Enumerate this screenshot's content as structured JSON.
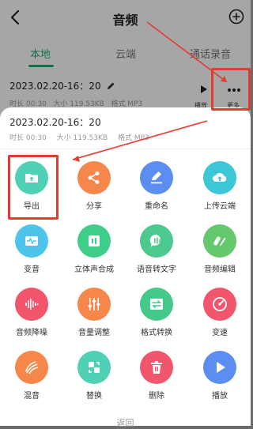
{
  "header": {
    "title": "音频"
  },
  "tabs": [
    {
      "label": "本地",
      "active": true
    },
    {
      "label": "云端",
      "active": false
    },
    {
      "label": "通话录音",
      "active": false
    }
  ],
  "recording": {
    "name": "2023.02.20-16：20",
    "duration": "时长 00:30",
    "size": "大小 119.53KB",
    "format": "格式 MP3",
    "play_label": "播放",
    "more_label": "更多"
  },
  "sheet": {
    "name": "2023.02.20-16：20",
    "duration": "时长 00:30",
    "size": "大小 119.53KB",
    "format": "格式 MP3",
    "actions": [
      {
        "label": "导出",
        "icon": "folder-upload-icon",
        "color": "#4fd0b4"
      },
      {
        "label": "分享",
        "icon": "share-icon",
        "color": "#f6874a"
      },
      {
        "label": "重命名",
        "icon": "rename-icon",
        "color": "#5c8ef2"
      },
      {
        "label": "上传云端",
        "icon": "cloud-upload-icon",
        "color": "#3cc6d8"
      },
      {
        "label": "变音",
        "icon": "voice-change-icon",
        "color": "#4dc4ea"
      },
      {
        "label": "立体声合成",
        "icon": "stereo-icon",
        "color": "#3fce8a"
      },
      {
        "label": "语音转文字",
        "icon": "speech-to-text-icon",
        "color": "#4cc98e"
      },
      {
        "label": "音频编辑",
        "icon": "audio-edit-icon",
        "color": "#66c86d"
      },
      {
        "label": "音频降噪",
        "icon": "noise-reduction-icon",
        "color": "#f2566c"
      },
      {
        "label": "音量调整",
        "icon": "volume-adjust-icon",
        "color": "#f6874a"
      },
      {
        "label": "格式转换",
        "icon": "format-convert-icon",
        "color": "#45c98b"
      },
      {
        "label": "变速",
        "icon": "speed-icon",
        "color": "#f2566c"
      },
      {
        "label": "混音",
        "icon": "mix-icon",
        "color": "#f6874a"
      },
      {
        "label": "替换",
        "icon": "replace-icon",
        "color": "#4fd0b4"
      },
      {
        "label": "删除",
        "icon": "delete-icon",
        "color": "#f2566c"
      },
      {
        "label": "播放",
        "icon": "play-icon",
        "color": "#5c8ef2"
      }
    ],
    "footer_label": "返回"
  },
  "highlight_color": "#e53a2f"
}
